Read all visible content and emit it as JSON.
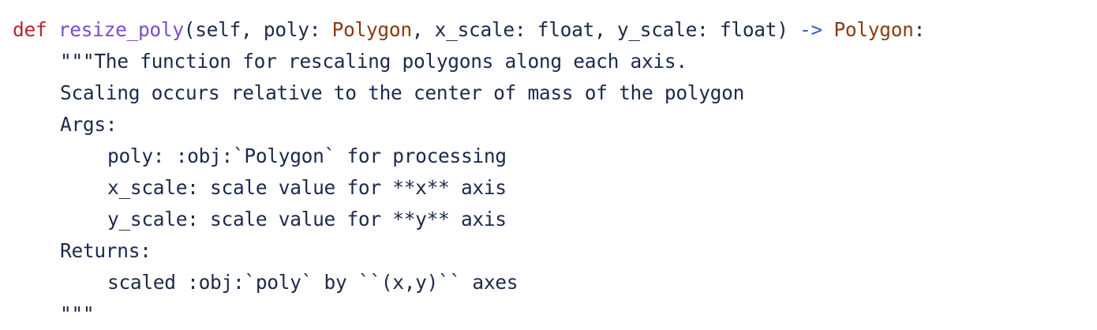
{
  "code": {
    "signature": {
      "keyword": "def",
      "function_name": "resize_poly",
      "params_part1": "(self, poly: ",
      "type_polygon": "Polygon",
      "params_part2": ", x_scale: float, y_scale: float) ",
      "arrow": "->",
      "return_type": "Polygon",
      "colon": ":"
    },
    "docstring": [
      "\"\"\"The function for rescaling polygons along each axis.",
      "Scaling occurs relative to the center of mass of the polygon",
      "Args:",
      "poly: :obj:`Polygon` for processing",
      "x_scale: scale value for **x** axis",
      "y_scale: scale value for **y** axis",
      "Returns:",
      "scaled :obj:`poly` by ``(x,y)`` axes",
      "\"\"\""
    ]
  },
  "colors": {
    "keyword": "#b5262c",
    "function": "#7c4dca",
    "type": "#8a3b0f",
    "arrow": "#2f5fbf",
    "text": "#1b2a4a"
  }
}
